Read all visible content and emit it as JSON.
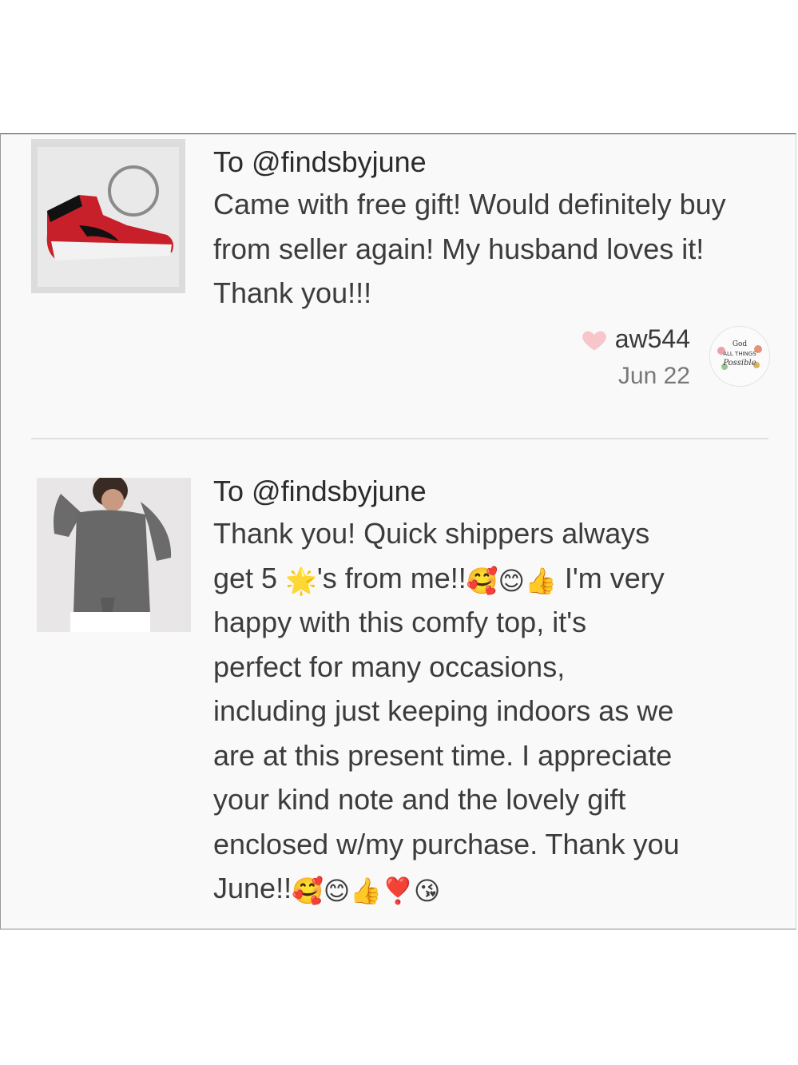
{
  "reviews": [
    {
      "to": "To @findsbyjune",
      "body": "Came with free gift! Would definitely buy from seller again! My husband loves it! Thank you!!!",
      "user": "aw544",
      "date": "Jun 22",
      "thumbnail_icon": "sneaker-keychain-image",
      "avatar_text": "With God All Things Are Possible"
    },
    {
      "to": "To @findsbyjune",
      "body_lines": [
        "Thank you! Quick shippers always",
        "get 5 ",
        "'s from me!!",
        " I'm very",
        "happy with this comfy top, it's",
        "perfect for many occasions,",
        "including just keeping indoors as we",
        "are at this present time. I appreciate",
        "your kind note and the lovely gift",
        "enclosed w/my purchase. Thank you",
        "June!!"
      ],
      "thumbnail_icon": "woman-top-image"
    }
  ],
  "colors": {
    "panel_bg": "#faf9f9",
    "heart": "#f6c6cb",
    "text": "#3c3c3c",
    "muted": "#777777"
  }
}
